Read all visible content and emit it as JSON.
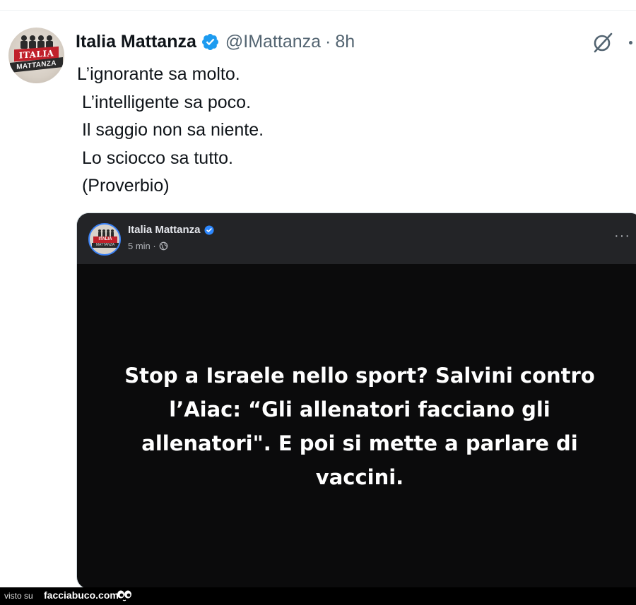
{
  "tweet": {
    "display_name": "Italia Mattanza",
    "handle": "@IMattanza",
    "separator": "·",
    "time": "8h",
    "avatar_text": {
      "banner": "ITALIA",
      "sub": "MATTANZA"
    },
    "lines": [
      "L’ignorante sa molto.",
      " L’intelligente sa poco.",
      " Il saggio non sa niente.",
      " Lo sciocco sa tutto.",
      " (Proverbio)"
    ]
  },
  "embedded_post": {
    "author": "Italia Mattanza",
    "meta": "5 min ·",
    "more": "···",
    "headline_lines": [
      "Stop a Israele nello sport? Salvini contro",
      "l’Aiac: “Gli allenatori facciano gli",
      "allenatori\". E poi si mette a parlare di",
      "vaccini."
    ]
  },
  "footer": {
    "prefix": "visto su",
    "brand": "facciabuco.com"
  },
  "icons": {
    "verified": "verified-badge-icon",
    "grok": "grok-icon",
    "more": "more-icon",
    "globe": "globe-icon"
  },
  "colors": {
    "verified_blue": "#1d9bf0",
    "secondary_text": "#536471",
    "card_bg": "#0b0b0c",
    "card_header_bg": "#232427"
  }
}
